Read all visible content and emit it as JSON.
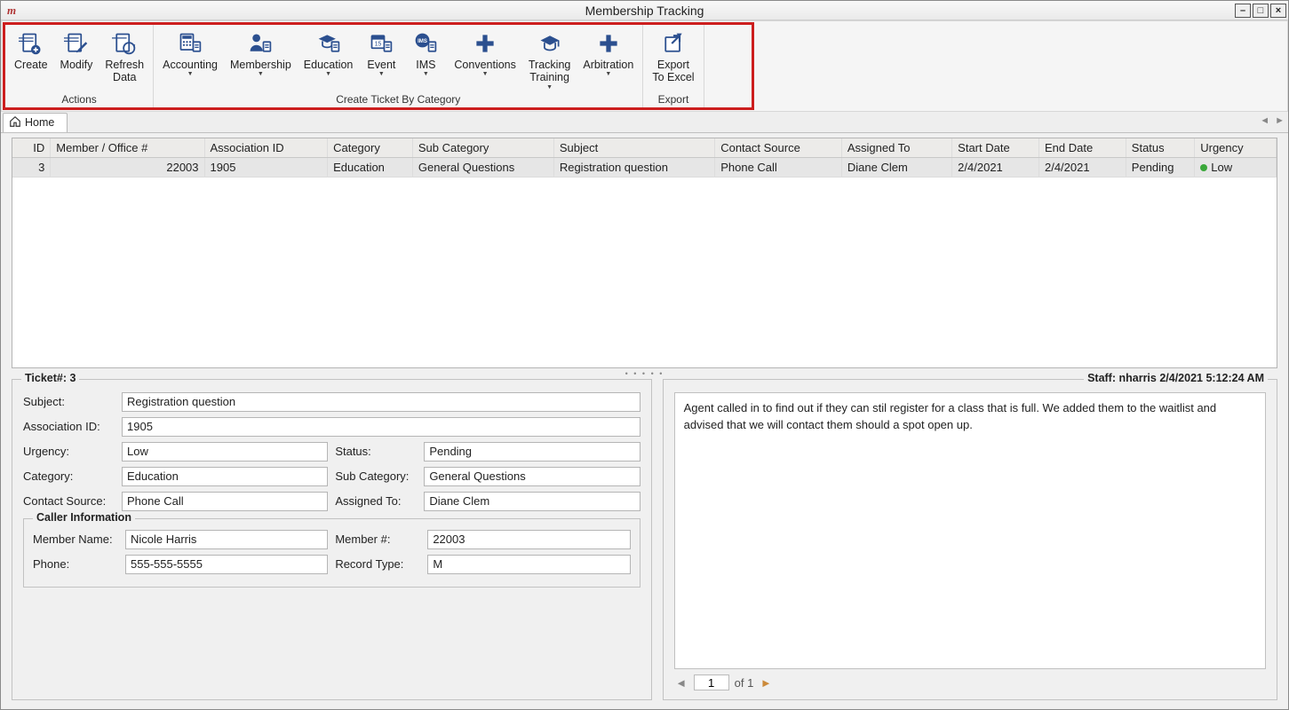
{
  "window": {
    "title": "Membership Tracking"
  },
  "ribbon": {
    "groups": [
      {
        "label": "Actions",
        "buttons": [
          {
            "id": "create",
            "label": "Create",
            "dropdown": false,
            "icon": "doc-plus"
          },
          {
            "id": "modify",
            "label": "Modify",
            "dropdown": false,
            "icon": "doc-pencil"
          },
          {
            "id": "refresh",
            "label": "Refresh\nData",
            "dropdown": false,
            "icon": "doc-refresh"
          }
        ]
      },
      {
        "label": "Create Ticket By Category",
        "buttons": [
          {
            "id": "accounting",
            "label": "Accounting",
            "dropdown": true,
            "icon": "calc-doc"
          },
          {
            "id": "membership",
            "label": "Membership",
            "dropdown": true,
            "icon": "person-doc"
          },
          {
            "id": "education",
            "label": "Education",
            "dropdown": true,
            "icon": "grad-doc"
          },
          {
            "id": "event",
            "label": "Event",
            "dropdown": true,
            "icon": "cal-doc"
          },
          {
            "id": "ims",
            "label": "IMS",
            "dropdown": true,
            "icon": "ims-doc"
          },
          {
            "id": "conventions",
            "label": "Conventions",
            "dropdown": true,
            "icon": "plus"
          },
          {
            "id": "tracking",
            "label": "Tracking\nTraining",
            "dropdown": true,
            "icon": "grad"
          },
          {
            "id": "arbitration",
            "label": "Arbitration",
            "dropdown": true,
            "icon": "plus"
          }
        ]
      },
      {
        "label": "Export",
        "buttons": [
          {
            "id": "export",
            "label": "Export\nTo Excel",
            "dropdown": false,
            "icon": "export"
          }
        ]
      }
    ]
  },
  "tab": {
    "label": "Home"
  },
  "grid": {
    "headers": [
      "ID",
      "Member / Office #",
      "Association ID",
      "Category",
      "Sub Category",
      "Subject",
      "Contact Source",
      "Assigned To",
      "Start Date",
      "End Date",
      "Status",
      "Urgency"
    ],
    "widths": [
      "42px",
      "170px",
      "136px",
      "94px",
      "156px",
      "178px",
      "140px",
      "122px",
      "96px",
      "96px",
      "76px",
      "90px"
    ],
    "rows": [
      {
        "id": "3",
        "member": "22003",
        "assoc": "1905",
        "category": "Education",
        "subcat": "General Questions",
        "subject": "Registration question",
        "source": "Phone Call",
        "assigned": "Diane Clem",
        "start": "2/4/2021",
        "end": "2/4/2021",
        "status": "Pending",
        "urgency": "Low"
      }
    ]
  },
  "ticket": {
    "title_prefix": "Ticket#:",
    "number": "3",
    "labels": {
      "subject": "Subject:",
      "assoc": "Association ID:",
      "urgency": "Urgency:",
      "status": "Status:",
      "category": "Category:",
      "subcat": "Sub Category:",
      "source": "Contact Source:",
      "assigned": "Assigned To:"
    },
    "values": {
      "subject": "Registration question",
      "assoc": "1905",
      "urgency": "Low",
      "status": "Pending",
      "category": "Education",
      "subcat": "General Questions",
      "source": "Phone Call",
      "assigned": "Diane Clem"
    },
    "caller": {
      "title": "Caller Information",
      "labels": {
        "name": "Member Name:",
        "num": "Member #:",
        "phone": "Phone:",
        "rtype": "Record Type:"
      },
      "values": {
        "name": "Nicole Harris",
        "num": "22003",
        "phone": "555-555-5555",
        "rtype": "M"
      }
    }
  },
  "notes": {
    "staff_label": "Staff: nharris 2/4/2021 5:12:24 AM",
    "body": "Agent called in to find out if they can stil register for a class that is full. We added them to the waitlist and advised that we will contact them should a spot open up.",
    "pager": {
      "page": "1",
      "of_label": "of 1"
    }
  }
}
